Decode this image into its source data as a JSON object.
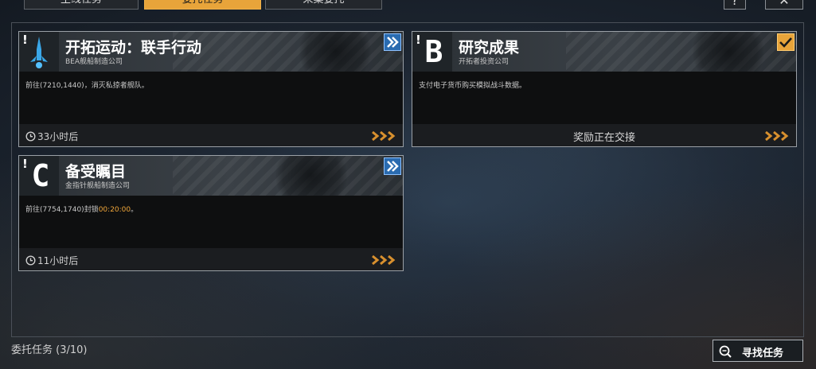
{
  "tabs": [
    {
      "label": "主线任务",
      "active": false
    },
    {
      "label": "委托任务",
      "active": true
    },
    {
      "label": "采集委托",
      "active": false
    }
  ],
  "header_buttons": {
    "help": "?",
    "close": "✕"
  },
  "cards": [
    {
      "letter": "",
      "icon": "rocket-icon",
      "flag": "double-chevron-icon",
      "title": "开拓运动：联手行动",
      "subtitle": "BEA舰船制造公司",
      "desc": "前往(7210,1440)，消灭私掠者舰队。",
      "desc_highlight": "",
      "desc_tail": "",
      "timer": "33小时后",
      "reward_text": ""
    },
    {
      "letter": "B",
      "icon": "",
      "flag": "checkmark-icon",
      "title": "研究成果",
      "subtitle": "开拓者投资公司",
      "desc": "支付电子货币购买模拟战斗数据。",
      "desc_highlight": "",
      "desc_tail": "",
      "timer": "",
      "reward_text": "奖励正在交接"
    },
    {
      "letter": "C",
      "icon": "",
      "flag": "double-chevron-icon",
      "title": "备受瞩目",
      "subtitle": "金指针舰船制造公司",
      "desc": "前往(7754,1740)封锁",
      "desc_highlight": "00:20:00",
      "desc_tail": "。",
      "timer": "11小时后",
      "reward_text": ""
    }
  ],
  "footer": {
    "task_count_label": "委托任务 (3/10)",
    "find_button_label": "寻找任务"
  },
  "colors": {
    "accent_orange": "#e8a43a",
    "flag_blue": "#2a6bb0",
    "highlight_text": "#f0a63a"
  }
}
